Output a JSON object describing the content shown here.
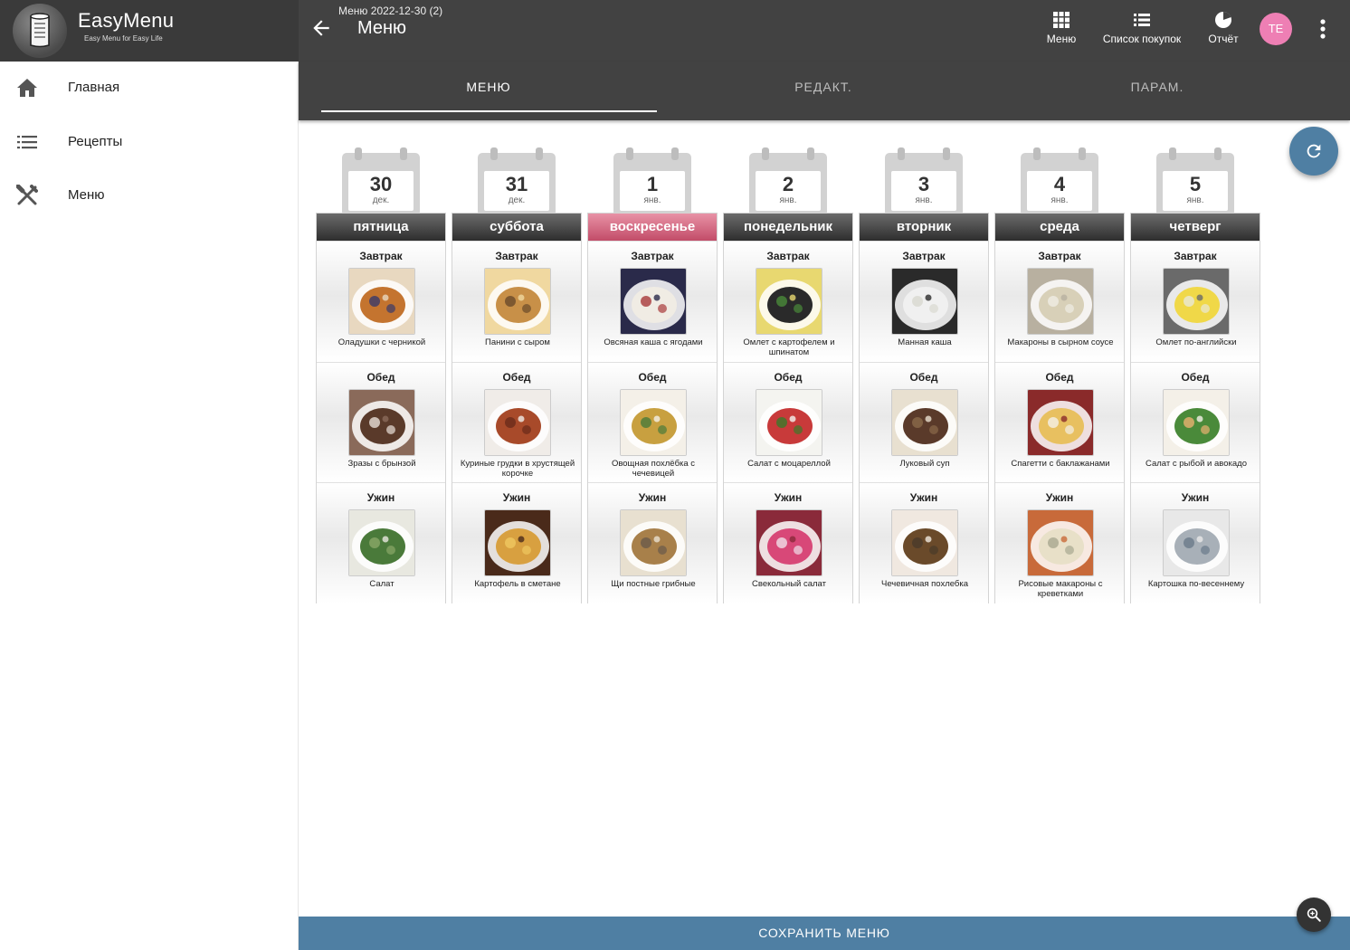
{
  "app": {
    "name": "EasyMenu",
    "tagline": "Easy Menu for Easy Life"
  },
  "header": {
    "subtitle": "Меню 2022-12-30 (2)",
    "title": "Меню"
  },
  "actions": [
    {
      "label": "Меню",
      "icon": "grid-icon"
    },
    {
      "label": "Список покупок",
      "icon": "list-icon"
    },
    {
      "label": "Отчёт",
      "icon": "pie-chart-icon"
    }
  ],
  "user": {
    "initials": "TE",
    "color": "#ee7fb4"
  },
  "sidebar": {
    "items": [
      {
        "label": "Главная",
        "icon": "home-icon"
      },
      {
        "label": "Рецепты",
        "icon": "list-icon"
      },
      {
        "label": "Меню",
        "icon": "cutlery-icon"
      }
    ]
  },
  "tabs": [
    {
      "label": "МЕНЮ",
      "active": true
    },
    {
      "label": "РЕДАКТ.",
      "active": false
    },
    {
      "label": "ПАРАМ.",
      "active": false
    }
  ],
  "meal_labels": [
    "Завтрак",
    "Обед",
    "Ужин"
  ],
  "days": [
    {
      "num": "30",
      "month": "дек.",
      "name": "пятница",
      "highlight": false,
      "meals": [
        {
          "dish": "Оладушки с черникой",
          "colors": [
            "#c4742f",
            "#e8d8c0",
            "#3a3a6a"
          ]
        },
        {
          "dish": "Зразы с брынзой",
          "colors": [
            "#5a3a2a",
            "#8a6a5a",
            "#e8e0d8"
          ]
        },
        {
          "dish": "Салат",
          "colors": [
            "#4a7a3a",
            "#e8e8e0",
            "#8aa868"
          ]
        }
      ]
    },
    {
      "num": "31",
      "month": "дек.",
      "name": "суббота",
      "highlight": false,
      "meals": [
        {
          "dish": "Панини с сыром",
          "colors": [
            "#c89048",
            "#f0d8a0",
            "#6a4a2a"
          ]
        },
        {
          "dish": "Куриные грудки в хрустящей корочке",
          "colors": [
            "#a84a2a",
            "#f0ece8",
            "#6a2a1a"
          ]
        },
        {
          "dish": "Картофель в сметане",
          "colors": [
            "#d8a040",
            "#4a2a1a",
            "#f0c860"
          ]
        }
      ]
    },
    {
      "num": "1",
      "month": "янв.",
      "name": "воскресенье",
      "highlight": true,
      "meals": [
        {
          "dish": "Овсяная каша с ягодами",
          "colors": [
            "#f0ece4",
            "#2a2a4a",
            "#a83a3a"
          ]
        },
        {
          "dish": "Овощная похлёбка с чечевицей",
          "colors": [
            "#c8a040",
            "#f4f0e8",
            "#4a7a3a"
          ]
        },
        {
          "dish": "Щи постные грибные",
          "colors": [
            "#a8804a",
            "#e8e0d0",
            "#6a5a4a"
          ]
        }
      ]
    },
    {
      "num": "2",
      "month": "янв.",
      "name": "понедельник",
      "highlight": false,
      "meals": [
        {
          "dish": "Омлет с картофелем и шпинатом",
          "colors": [
            "#2a2a2a",
            "#e8d870",
            "#4a8a3a"
          ]
        },
        {
          "dish": "Салат с моцареллой",
          "colors": [
            "#c83a3a",
            "#f4f4f0",
            "#3a7a2a"
          ]
        },
        {
          "dish": "Свекольный салат",
          "colors": [
            "#d84878",
            "#8a2a3a",
            "#f0e0e8"
          ]
        }
      ]
    },
    {
      "num": "3",
      "month": "янв.",
      "name": "вторник",
      "highlight": false,
      "meals": [
        {
          "dish": "Манная каша",
          "colors": [
            "#f0f0f0",
            "#2a2a2a",
            "#d8d8d0"
          ]
        },
        {
          "dish": "Луковый суп",
          "colors": [
            "#5a3a2a",
            "#e8e0d0",
            "#8a6a4a"
          ]
        },
        {
          "dish": "Чечевичная похлебка",
          "colors": [
            "#6a4a2a",
            "#f0e8e0",
            "#4a3a2a"
          ]
        }
      ]
    },
    {
      "num": "4",
      "month": "янв.",
      "name": "среда",
      "highlight": false,
      "meals": [
        {
          "dish": "Макароны в сырном соусе",
          "colors": [
            "#d8d0b8",
            "#b8b0a0",
            "#f0ece4"
          ]
        },
        {
          "dish": "Спагетти с баклажанами",
          "colors": [
            "#e8c060",
            "#8a2a2a",
            "#f4f0e8"
          ]
        },
        {
          "dish": "Рисовые макароны с креветками",
          "colors": [
            "#e8e0c8",
            "#c86a3a",
            "#a8a890"
          ]
        }
      ]
    },
    {
      "num": "5",
      "month": "янв.",
      "name": "четверг",
      "highlight": false,
      "meals": [
        {
          "dish": "Омлет по-английски",
          "colors": [
            "#f0d848",
            "#6a6a6a",
            "#e8e8d8"
          ]
        },
        {
          "dish": "Салат с рыбой и авокадо",
          "colors": [
            "#4a8a3a",
            "#f4f0e8",
            "#e8b070"
          ]
        },
        {
          "dish": "Картошка по-весеннему",
          "colors": [
            "#a8b0b8",
            "#e8e8e8",
            "#6a7a8a"
          ]
        }
      ]
    }
  ],
  "save_label": "СОХРАНИТЬ МЕНЮ",
  "accent": "#4f7fa3"
}
